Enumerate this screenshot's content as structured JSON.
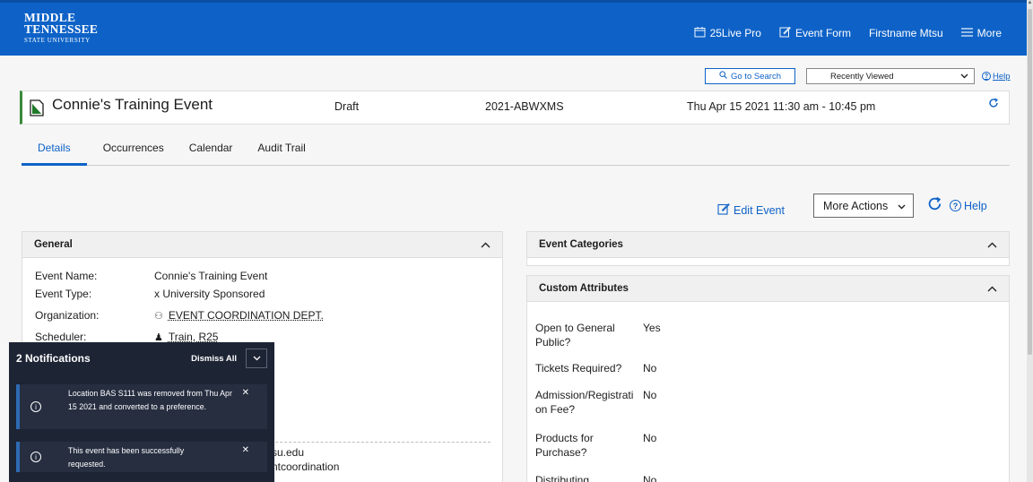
{
  "header": {
    "logo_line1": "MIDDLE",
    "logo_line2": "TENNESSEE",
    "logo_line3": "STATE UNIVERSITY",
    "nav": [
      {
        "label": "25Live Pro",
        "icon": "calendar-icon"
      },
      {
        "label": "Event Form",
        "icon": "edit-icon"
      },
      {
        "label": "Firstname Mtsu"
      },
      {
        "label": "More",
        "icon": "menu-icon"
      }
    ]
  },
  "search": {
    "goto_label": "Go to Search",
    "recent_label": "Recently Viewed",
    "help_label": "Help"
  },
  "event": {
    "title": "Connie's Training Event",
    "state": "Draft",
    "reference": "2021-ABWXMS",
    "datetime": "Thu Apr 15 2021 11:30 am - 10:45 pm"
  },
  "tabs": [
    "Details",
    "Occurrences",
    "Calendar",
    "Audit Trail"
  ],
  "actions": {
    "edit_label": "Edit Event",
    "more_actions_label": "More Actions",
    "help_label": "Help"
  },
  "general": {
    "title": "General",
    "rows": [
      {
        "label": "Event Name:",
        "value": "Connie's Training Event"
      },
      {
        "label": "Event Type:",
        "value": "x University Sponsored"
      },
      {
        "label": "Organization:",
        "value": "EVENT COORDINATION DEPT."
      },
      {
        "label": "Scheduler:",
        "value": "Train, R25"
      }
    ],
    "email_fragment_1": "su.edu",
    "email_fragment_2": "ntcoordination"
  },
  "categories": {
    "title": "Event Categories"
  },
  "custom_attributes": {
    "title": "Custom Attributes",
    "rows": [
      {
        "label": "Open to General Public?",
        "value": "Yes"
      },
      {
        "label": "Tickets Required?",
        "value": "No"
      },
      {
        "label": "Admission/Registration Fee?",
        "value": "No"
      },
      {
        "label": "Products for Purchase?",
        "value": "No"
      },
      {
        "label": "Distributing",
        "value": "No"
      }
    ]
  },
  "notifications": {
    "count_label": "2 Notifications",
    "dismiss_label": "Dismiss All",
    "items": [
      {
        "message": "Location BAS S111 was removed from Thu Apr 15 2021 and converted to a preference."
      },
      {
        "message": "This event has been successfully requested."
      }
    ]
  },
  "colors": {
    "brand_blue": "#0e62c7",
    "status_green": "#3a8a3a",
    "notification_bg": "#1d2434"
  }
}
